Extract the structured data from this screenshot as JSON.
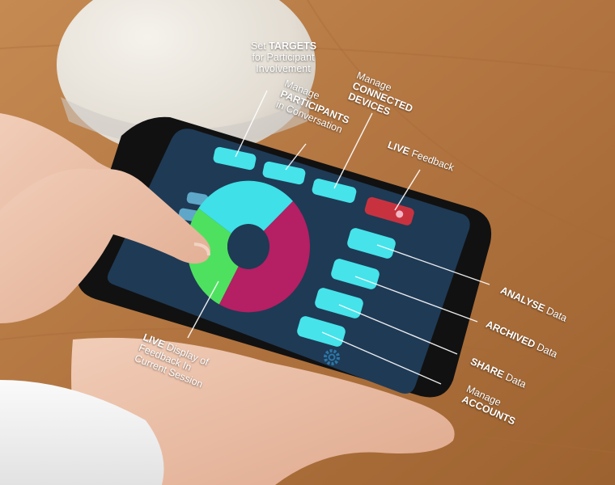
{
  "annotations": {
    "targets": {
      "line1": "Set",
      "strong": "TARGETS",
      "line2": "for Participant",
      "line3": "Involvement"
    },
    "participants": {
      "line1": "Manage",
      "strong": "PARTICIPANTS",
      "line2": "in Conversation"
    },
    "devices": {
      "line1": "Manage",
      "strong1": "CONNECTED",
      "strong2": "DEVICES"
    },
    "live_feedback": {
      "strong": "LIVE",
      "rest": "Feedback"
    },
    "analyse": {
      "strong": "ANALYSE",
      "rest": "Data"
    },
    "archived": {
      "strong": "ARCHIVED",
      "rest": "Data"
    },
    "share": {
      "strong": "SHARE",
      "rest": "Data"
    },
    "accounts": {
      "line1": "Manage",
      "strong": "ACCOUNTS"
    },
    "live_display": {
      "strong": "LIVE",
      "line1_rest": "Display of",
      "line2": "Feedback In",
      "line3": "Current Session"
    }
  },
  "colors": {
    "table": "#b77a46",
    "screen_bg": "#1f3a55",
    "button_cyan": "#46e3ea",
    "chart_cyan": "#3fe0e8",
    "chart_magenta": "#b51f63",
    "chart_green": "#4ee15f",
    "live_red": "#c8323f"
  },
  "chart_data": {
    "type": "pie",
    "categories": [
      "cyan",
      "magenta",
      "green"
    ],
    "values": [
      28,
      45,
      27
    ]
  },
  "icons": {
    "settings": "gear-icon",
    "record": "record-icon"
  }
}
